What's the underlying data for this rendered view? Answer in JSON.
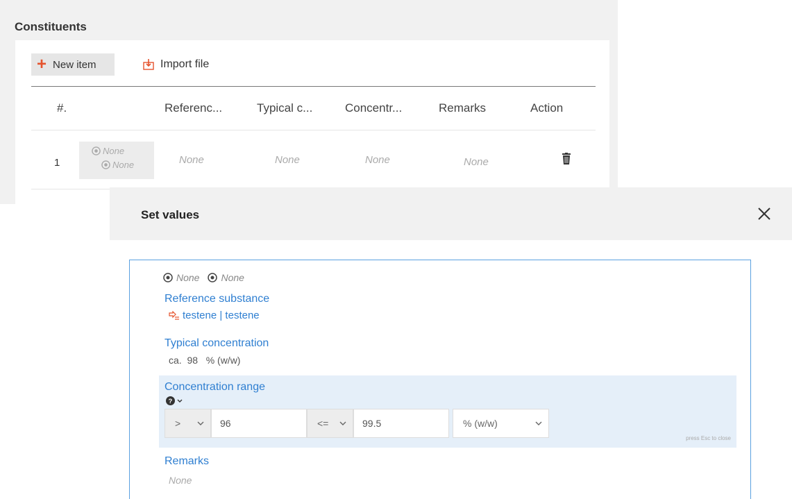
{
  "constituents": {
    "title": "Constituents",
    "toolbar": {
      "new_item_label": "New item",
      "import_file_label": "Import file"
    },
    "table": {
      "headers": [
        "#.",
        "Referenc...",
        "Typical c...",
        "Concentr...",
        "Remarks",
        "Action"
      ],
      "rows": [
        {
          "num": "1",
          "badge_line_1": "None",
          "badge_line_2": "None",
          "reference": "None",
          "typical": "None",
          "concentration": "None",
          "remarks": "None"
        }
      ]
    }
  },
  "modal": {
    "title": "Set values",
    "badges": [
      "None",
      "None"
    ],
    "reference_substance": {
      "label": "Reference substance",
      "value": "testene | testene"
    },
    "typical_concentration": {
      "label": "Typical concentration",
      "value": "ca.  98   % (w/w)"
    },
    "concentration_range": {
      "label": "Concentration range",
      "lower_qualifier": ">",
      "lower_value": "96",
      "upper_qualifier": "<=",
      "upper_value": "99.5",
      "unit": "% (w/w)",
      "esc_hint": "press Esc to close"
    },
    "remarks": {
      "label": "Remarks",
      "value": "None"
    }
  },
  "colors": {
    "accent_blue": "#2f7fd1",
    "accent_orange": "#e5532d",
    "panel_border": "#5aa0e0",
    "highlight_band": "#e5eff9"
  },
  "icons": [
    "plus-icon",
    "import-file-icon",
    "badge-icon",
    "trash-icon",
    "close-icon",
    "substance-icon",
    "help-icon",
    "chevron-down-icon"
  ]
}
